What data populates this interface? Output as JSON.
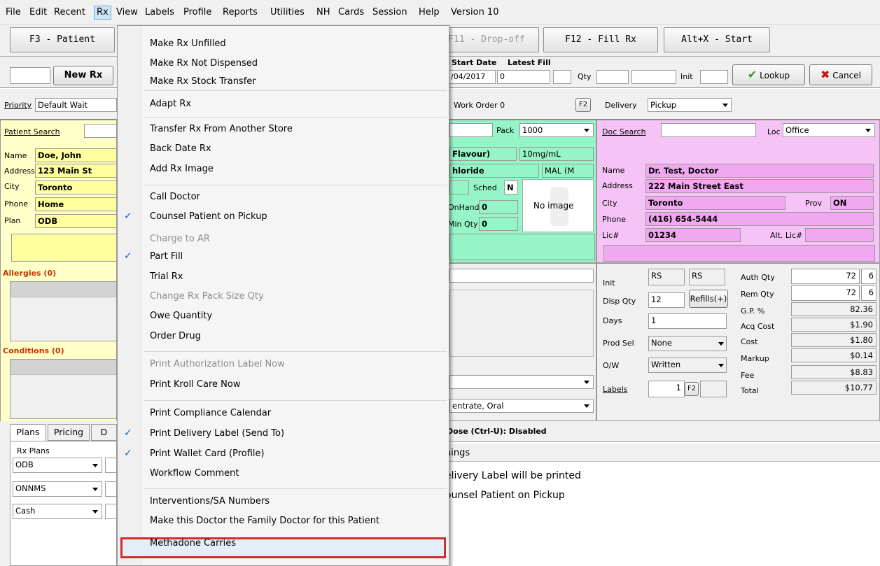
{
  "menubar": {
    "items": [
      "File",
      "Edit",
      "Recent",
      "Rx",
      "View",
      "Labels",
      "Profile",
      "Reports",
      "Utilities",
      "NH",
      "Cards",
      "Session",
      "Help",
      "Version 10"
    ]
  },
  "toolbar": {
    "f3": "F3 - Patient",
    "f11": "F11 - Drop-off",
    "f12": "F12 - Fill Rx",
    "altx": "Alt+X - Start"
  },
  "rxbar": {
    "new_rx": "New Rx",
    "start_date_label": "Start Date",
    "latest_fill_label": "Latest Fill",
    "start_date_value": "/04/2017",
    "latest_fill_value": "0",
    "qty_label": "Qty",
    "init_label": "Init",
    "lookup": "Lookup",
    "cancel": "Cancel"
  },
  "priority": {
    "label": "Priority",
    "value": "Default Wait",
    "work_order_label": "Work Order",
    "work_order_value": "0",
    "f2": "F2",
    "delivery_label": "Delivery",
    "delivery_value": "Pickup"
  },
  "patient": {
    "search_label": "Patient Search",
    "name_label": "Name",
    "name": "Doe, John",
    "address_label": "Address",
    "address": "123 Main St",
    "city_label": "City",
    "city": "Toronto",
    "phone_label": "Phone",
    "phone": "Home",
    "plan_label": "Plan",
    "plan": "ODB",
    "allergies": "Allergies (0)",
    "conditions": "Conditions (0)"
  },
  "drug": {
    "pack_label": "Pack",
    "pack_value": "1000",
    "name_partial": "Flavour)",
    "strength": "10mg/mL",
    "generic_partial": "hloride",
    "mfr_partial": "MAL (M",
    "sched_label": "Sched",
    "sched_value": "N",
    "onhand_label": "OnHand",
    "onhand_value": "0",
    "minqty_label": "Min Qty",
    "minqty_value": "0",
    "no_image": "No image",
    "form_partial": "entrate, Oral"
  },
  "doctor": {
    "search_label": "Doc Search",
    "loc_label": "Loc",
    "loc_value": "Office",
    "name_label": "Name",
    "name": "Dr. Test, Doctor",
    "address_label": "Address",
    "address": "222 Main Street East",
    "city_label": "City",
    "city": "Toronto",
    "prov_label": "Prov",
    "prov": "ON",
    "phone_label": "Phone",
    "phone": "(416) 654-5444",
    "lic_label": "Lic#",
    "lic": "01234",
    "alt_lic_label": "Alt. Lic#"
  },
  "rxdetail": {
    "init_label": "Init",
    "init1": "RS",
    "init2": "RS",
    "disp_qty_label": "Disp Qty",
    "disp_qty": "12",
    "refills_btn": "Refills(+)",
    "days_label": "Days",
    "days": "1",
    "prod_sel_label": "Prod Sel",
    "prod_sel": "None",
    "ow_label": "O/W",
    "ow": "Written",
    "labels_label": "Labels",
    "labels_value": "1",
    "f2": "F2"
  },
  "pricing": {
    "auth_qty_label": "Auth Qty",
    "auth_qty": "72",
    "auth_qty2": "6",
    "rem_qty_label": "Rem Qty",
    "rem_qty": "72",
    "rem_qty2": "6",
    "gp_label": "G.P. %",
    "gp": "82.36",
    "acq_label": "Acq Cost",
    "acq": "$1.90",
    "cost_label": "Cost",
    "cost": "$1.80",
    "markup_label": "Markup",
    "markup": "$0.14",
    "fee_label": "Fee",
    "fee": "$8.83",
    "total_label": "Total",
    "total": "$10.77"
  },
  "bottom": {
    "tabs": [
      "Plans",
      "Pricing",
      "D"
    ],
    "rx_plans_label": "Rx Plans",
    "plans": [
      "ODB",
      "ONNMS",
      "Cash"
    ],
    "dose_text": "Dose (Ctrl-U): Disabled",
    "warnings_header": "nings",
    "warning1": "elivery Label will be printed",
    "warning2": "ounsel Patient on Pickup"
  },
  "rx_menu": {
    "items": [
      {
        "label": "Make Rx Unfilled",
        "disabled": false,
        "checked": false
      },
      {
        "label": "Make Rx Not Dispensed",
        "disabled": false,
        "checked": false
      },
      {
        "label": "Make Rx Stock Transfer",
        "disabled": false,
        "checked": false
      },
      {
        "label": "Adapt Rx",
        "disabled": false,
        "checked": false
      },
      {
        "label": "Transfer Rx From Another Store",
        "disabled": false,
        "checked": false
      },
      {
        "label": "Back Date Rx",
        "disabled": false,
        "checked": false
      },
      {
        "label": "Add Rx Image",
        "disabled": false,
        "checked": false
      },
      {
        "label": "Call Doctor",
        "disabled": false,
        "checked": false
      },
      {
        "label": "Counsel Patient on Pickup",
        "disabled": false,
        "checked": true
      },
      {
        "label": "Charge to AR",
        "disabled": true,
        "checked": false
      },
      {
        "label": "Part Fill",
        "disabled": false,
        "checked": true
      },
      {
        "label": "Trial Rx",
        "disabled": false,
        "checked": false
      },
      {
        "label": "Change Rx Pack Size Qty",
        "disabled": true,
        "checked": false
      },
      {
        "label": "Owe Quantity",
        "disabled": false,
        "checked": false
      },
      {
        "label": "Order Drug",
        "disabled": false,
        "checked": false
      },
      {
        "label": "Print Authorization Label Now",
        "disabled": true,
        "checked": false
      },
      {
        "label": "Print Kroll Care Now",
        "disabled": false,
        "checked": false
      },
      {
        "label": "Print Compliance Calendar",
        "disabled": false,
        "checked": false
      },
      {
        "label": "Print Delivery Label (Send To)",
        "disabled": false,
        "checked": true
      },
      {
        "label": "Print Wallet Card (Profile)",
        "disabled": false,
        "checked": true
      },
      {
        "label": "Workflow Comment",
        "disabled": false,
        "checked": false
      },
      {
        "label": "Interventions/SA Numbers",
        "disabled": false,
        "checked": false
      },
      {
        "label": "Make this Doctor the Family Doctor for this Patient",
        "disabled": false,
        "checked": false
      },
      {
        "label": "Methadone Carries",
        "disabled": false,
        "checked": false
      }
    ]
  },
  "colors": {
    "patient_bg": "#ffffc8",
    "drug_bg": "#96f5c8",
    "doctor_bg": "#f6c3f6",
    "highlight_border": "#d72a2a",
    "alert_red": "#cc3300"
  }
}
